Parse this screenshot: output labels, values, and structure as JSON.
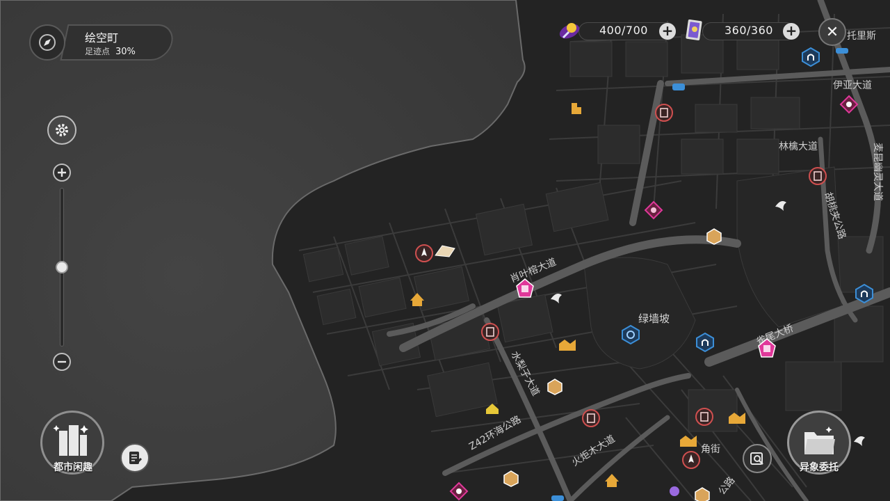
{
  "location": {
    "name": "绘空町",
    "progress_label": "足迹点",
    "progress_value": "30%"
  },
  "resources": {
    "battery": {
      "value": "400/700",
      "icon": "battery-plug-icon"
    },
    "card": {
      "value": "360/360",
      "icon": "film-card-icon"
    }
  },
  "buttons": {
    "city_fun_label": "都市闲趣",
    "commission_label": "异象委托",
    "close_symbol": "✕"
  },
  "map": {
    "streets": {
      "s1": "伊亚大道",
      "s2": "林檎大道",
      "s3": "胡桃夹公路",
      "s4": "麦昆幽灵大道",
      "s5": "肖叶榕大道",
      "s6": "水梨子大道",
      "s7": "Z42环海公路",
      "s8": "火炬木大道",
      "s9": "雀尾大桥",
      "s10": "角街",
      "s11": "托里斯",
      "s12": "公路"
    },
    "districts": {
      "d1": "绿墙坡"
    }
  },
  "zoom": {
    "level": 0.5
  },
  "colors": {
    "water": "#3d3d3d",
    "land": "#232323",
    "road": "#4a4a4a",
    "accent_pink": "#e0389a",
    "accent_blue": "#3c8fd8",
    "accent_red": "#c74a4a",
    "accent_gold": "#e7a838"
  }
}
